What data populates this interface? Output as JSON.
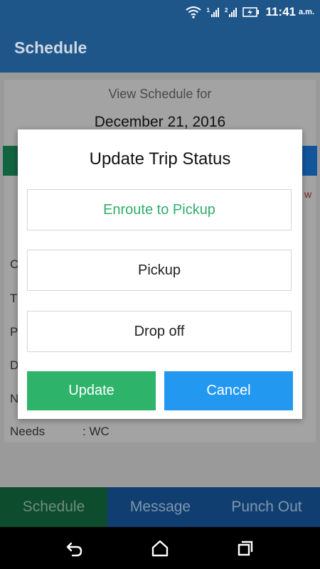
{
  "status_bar": {
    "time": "11:41",
    "ampm": "a.m.",
    "sim1_tag": "1",
    "sim2_tag": "2"
  },
  "app_bar": {
    "title": "Schedule"
  },
  "background": {
    "view_for_label": "View Schedule for",
    "date": "December 21, 2016",
    "side_letters": [
      "C",
      "T",
      "P",
      "D",
      "N"
    ],
    "red_fragment": "w",
    "needs_label": "Needs",
    "needs_value": ": WC"
  },
  "dialog": {
    "title": "Update Trip Status",
    "options": [
      {
        "label": "Enroute to Pickup",
        "selected": true
      },
      {
        "label": "Pickup",
        "selected": false
      },
      {
        "label": "Drop off",
        "selected": false
      }
    ],
    "update_label": "Update",
    "cancel_label": "Cancel"
  },
  "tabs": {
    "schedule": "Schedule",
    "message": "Message",
    "punch_out": "Punch Out"
  },
  "colors": {
    "app_bar": "#1f568a",
    "selected_option": "#2fae6b",
    "update_button": "#2eb36b",
    "cancel_button": "#2298f0"
  },
  "icons": {
    "wifi": "wifi-icon",
    "signal": "signal-icon",
    "battery": "battery-charging-icon",
    "back": "back-icon",
    "home": "home-icon",
    "recents": "recents-icon"
  }
}
